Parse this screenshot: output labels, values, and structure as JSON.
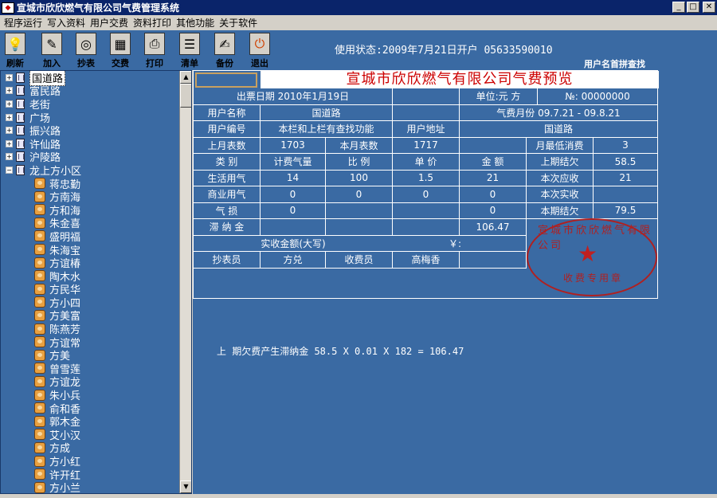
{
  "window": {
    "title": "宣城市欣欣燃气有限公司气费管理系统"
  },
  "menu": [
    "程序运行",
    "写入资料",
    "用户交费",
    "资料打印",
    "其他功能",
    "关于软件"
  ],
  "toolbar": [
    {
      "label": "刷新",
      "icon": "bulb-icon"
    },
    {
      "label": "加入",
      "icon": "add-icon"
    },
    {
      "label": "抄表",
      "icon": "meter-icon"
    },
    {
      "label": "交费",
      "icon": "calculator-icon"
    },
    {
      "label": "打印",
      "icon": "printer-icon"
    },
    {
      "label": "清单",
      "icon": "list-icon"
    },
    {
      "label": "备份",
      "icon": "backup-icon"
    },
    {
      "label": "退出",
      "icon": "exit-icon"
    }
  ],
  "status": {
    "text": "使用状态:2009年7月21日开户   05633590010",
    "search_label": "用户名首拼查找"
  },
  "tree": {
    "groups": [
      "国道路",
      "富民路",
      "老街",
      "广场",
      "振兴路",
      "许仙路",
      "沪陵路",
      "龙上方小区"
    ],
    "users": [
      "蒋忠勤",
      "方南海",
      "方和海",
      "朱金喜",
      "盛明福",
      "朱海宝",
      "方谊椿",
      "陶木水",
      "方民华",
      "方小四",
      "方美富",
      "陈燕芳",
      "方谊常",
      "方美",
      "曾雪莲",
      "方谊龙",
      "朱小兵",
      "俞和香",
      "郭木金",
      "艾小汉",
      "方成",
      "方小红",
      "许开红",
      "方小兰"
    ]
  },
  "bill": {
    "title": "宣城市欣欣燃气有限公司气费预览",
    "issue_date": "出票日期 2010年1月19日",
    "unit": "单位:元 方",
    "no": "№: 00000000",
    "user_name_label": "用户名称",
    "user_name": "国道路",
    "month_label": "气费月份 09.7.21 - 09.8.21",
    "user_no_label": "用户编号",
    "user_no_note": "本栏和上栏有查找功能",
    "address_label": "用户地址",
    "address": "国道路",
    "last_reading_label": "上月表数",
    "last_reading": "1703",
    "this_reading_label": "本月表数",
    "this_reading": "1717",
    "min_label": "月最低消费",
    "min_value": "3",
    "col_type": "类    别",
    "col_gas": "计费气量",
    "col_ratio": "比    例",
    "col_price": "单    价",
    "col_amount": "金    额",
    "prev_arrears_label": "上期结欠",
    "prev_arrears": "58.5",
    "living_label": "生活用气",
    "living_gas": "14",
    "living_ratio": "100",
    "living_price": "1.5",
    "living_amount": "21",
    "due_label": "本次应收",
    "due_value": "21",
    "commercial_label": "商业用气",
    "commercial_gas": "0",
    "commercial_ratio": "0",
    "commercial_price": "0",
    "commercial_amount": "0",
    "paid_label": "本次实收",
    "loss_label": "气    损",
    "loss_gas": "0",
    "loss_amount": "0",
    "arrears_label": "本期结欠",
    "arrears_value": "79.5",
    "late_fee_label": "滞 纳 金",
    "late_fee_value": "106.47",
    "paid_words_label": "实收金额(大写)",
    "yen": "￥:",
    "reader_label": "抄表员",
    "reader": "方兑",
    "cashier_label": "收费员",
    "cashier": "高梅香",
    "stamp_top": "宣城市欣欣燃气有限公司",
    "stamp_bottom": "收费专用章"
  },
  "formula": "上  期欠费产生滞纳金 58.5 X 0.01 X 182 = 106.47"
}
